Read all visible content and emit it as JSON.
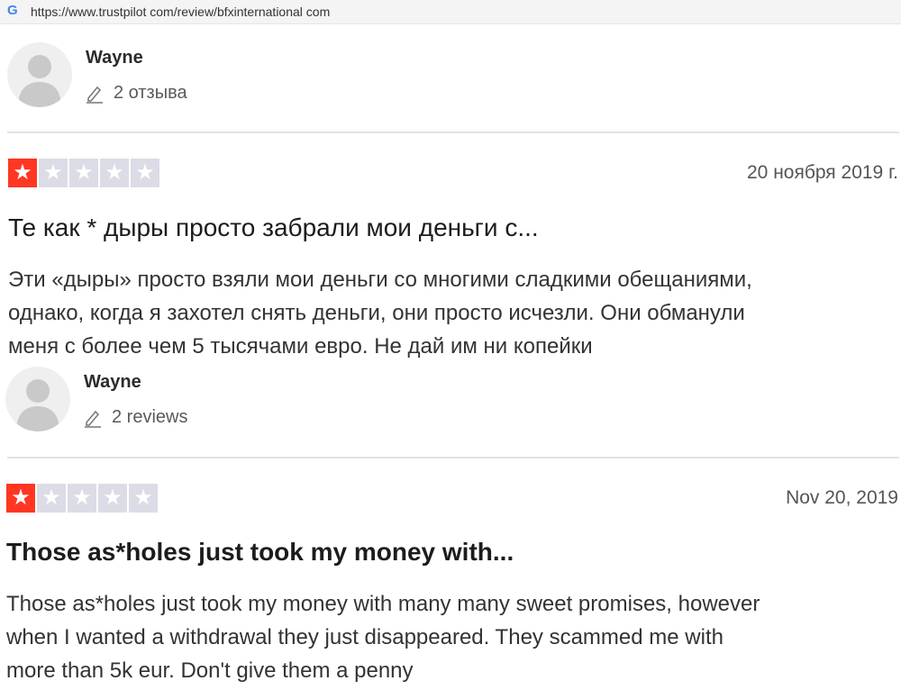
{
  "browser": {
    "url": "https://www.trustpilot com/review/bfxinternational com",
    "favicon_letter": "G"
  },
  "reviews": [
    {
      "author": "Wayne",
      "reviews_count": "2 отзыва",
      "rating": 1,
      "date": "20 ноября 2019 г.",
      "title": "Те как * дыры просто забрали мои деньги с...",
      "body_lines": [
        "Эти «дыры» просто взяли мои деньги со многими сладкими обещаниями,",
        "однако, когда я захотел снять деньги, они просто исчезли. Они обманули",
        "меня с более чем 5 тысячами евро. Не дай им ни копейки"
      ]
    },
    {
      "author": "Wayne",
      "reviews_count": "2 reviews",
      "rating": 1,
      "date": "Nov 20, 2019",
      "title": "Those as*holes just took my money with...",
      "body_lines": [
        "Those as*holes just took my money with many many sweet promises, however",
        "when I wanted a withdrawal they just disappeared. They scammed me with",
        "more than 5k eur. Don't give them a penny"
      ]
    }
  ],
  "colors": {
    "star_on": "#ff3722",
    "star_off": "#dcdce6"
  }
}
